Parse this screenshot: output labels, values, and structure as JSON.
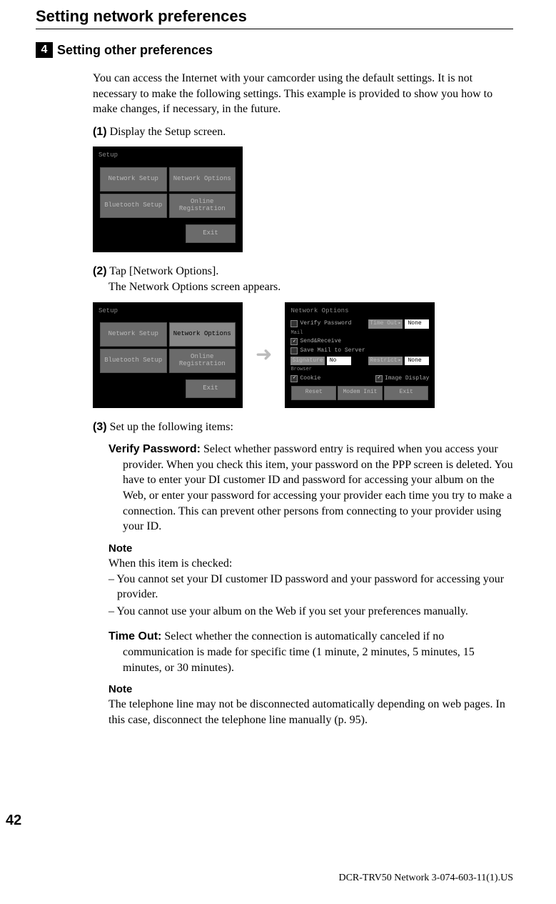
{
  "header": {
    "title": "Setting network preferences",
    "section_number": "4",
    "section_title": "Setting other preferences"
  },
  "intro": "You can access the Internet with your camcorder using the default settings. It is not necessary to make the following settings. This example is provided to show you how to make changes, if necessary, in the future.",
  "steps": {
    "s1": {
      "num": "(1)",
      "text": "Display the Setup screen."
    },
    "s2": {
      "num": "(2)",
      "text_a": "Tap [Network Options].",
      "text_b": "The Network Options screen appears."
    },
    "s3": {
      "num": "(3)",
      "text": "Set up the following items:"
    }
  },
  "screens": {
    "setup": {
      "title": "Setup",
      "btn1": "Network Setup",
      "btn2": "Network Options",
      "btn3": "Bluetooth Setup",
      "btn4": "Online\nRegistration",
      "exit": "Exit"
    },
    "netopt": {
      "title": "Network Options",
      "verify": "Verify Password",
      "timeout": "Time Out",
      "timeout_val": "None",
      "mail": "Mail",
      "sendreceive": "Send&Receive",
      "savemail": "Save Mail to Server",
      "signature": "Signature",
      "sig_val": "No",
      "restrict": "Restrict",
      "restrict_val": "None",
      "browser": "Browser",
      "cookie": "Cookie",
      "imgdisp": "Image Display",
      "reset": "Reset",
      "modem": "Modem Init",
      "exit": "Exit"
    }
  },
  "items": {
    "verify": {
      "heading": "Verify Password:",
      "desc": " Select whether password entry is required when you access your provider. When you check this item, your password on the PPP screen is deleted. You have to enter your DI customer ID and password for accessing your album on the Web, or enter your password for accessing your provider each time you try to make a connection. This can prevent other persons from connecting to your provider using your ID."
    },
    "note1": {
      "heading": "Note",
      "line1": "When this item is checked:",
      "dash1": "– You cannot set your DI customer ID password and your password for accessing your provider.",
      "dash2": "– You cannot use your album on the Web if you set your preferences manually."
    },
    "timeout": {
      "heading": "Time Out:",
      "desc": " Select whether the connection is automatically canceled if no communication is made for specific time (1 minute, 2 minutes, 5 minutes, 15 minutes, or 30 minutes)."
    },
    "note2": {
      "heading": "Note",
      "text": "The telephone line may not be disconnected automatically depending on web pages. In this case, disconnect the telephone line manually (p. 95)."
    }
  },
  "page_number": "42",
  "footer": "DCR-TRV50 Network 3-074-603-11(1).US"
}
